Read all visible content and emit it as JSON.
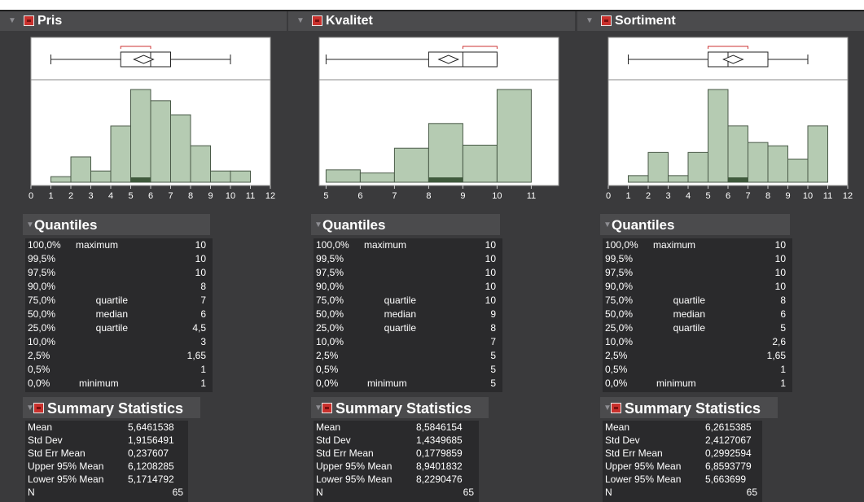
{
  "panels": [
    {
      "title": "Pris",
      "chart_data": {
        "type": "bar",
        "x_ticks": [
          "0",
          "1",
          "2",
          "3",
          "4",
          "5",
          "6",
          "7",
          "8",
          "9",
          "10",
          "11",
          "12"
        ],
        "xlim": [
          0,
          12
        ],
        "bins": [
          [
            1,
            2,
            2
          ],
          [
            2,
            3,
            9
          ],
          [
            3,
            4,
            4
          ],
          [
            4,
            5,
            20
          ],
          [
            5,
            6,
            33
          ],
          [
            6,
            7,
            29
          ],
          [
            7,
            8,
            24
          ],
          [
            8,
            9,
            13
          ],
          [
            9,
            10,
            4
          ],
          [
            10,
            11,
            4
          ]
        ],
        "box": {
          "whisker_low": 1,
          "q1": 4.5,
          "median": 6,
          "q3": 7,
          "whisker_high": 10,
          "mean": 5.65,
          "shortest_half": [
            4.5,
            6
          ]
        }
      },
      "quantiles_title": "Quantiles",
      "quantiles": [
        {
          "pct": "100,0%",
          "label": "maximum",
          "value": "10"
        },
        {
          "pct": "99,5%",
          "label": "",
          "value": "10"
        },
        {
          "pct": "97,5%",
          "label": "",
          "value": "10"
        },
        {
          "pct": "90,0%",
          "label": "",
          "value": "8"
        },
        {
          "pct": "75,0%",
          "label": "quartile",
          "value": "7"
        },
        {
          "pct": "50,0%",
          "label": "median",
          "value": "6"
        },
        {
          "pct": "25,0%",
          "label": "quartile",
          "value": "4,5"
        },
        {
          "pct": "10,0%",
          "label": "",
          "value": "3"
        },
        {
          "pct": "2,5%",
          "label": "",
          "value": "1,65"
        },
        {
          "pct": "0,5%",
          "label": "",
          "value": "1"
        },
        {
          "pct": "0,0%",
          "label": "minimum",
          "value": "1"
        }
      ],
      "summary_title": "Summary Statistics",
      "summary": [
        {
          "label": "Mean",
          "value": "5,6461538"
        },
        {
          "label": "Std Dev",
          "value": "1,9156491"
        },
        {
          "label": "Std Err Mean",
          "value": "0,237607"
        },
        {
          "label": "Upper 95% Mean",
          "value": "6,1208285"
        },
        {
          "label": "Lower 95% Mean",
          "value": "5,1714792"
        },
        {
          "label": "N",
          "value": "65"
        }
      ]
    },
    {
      "title": "Kvalitet",
      "chart_data": {
        "type": "bar",
        "x_ticks": [
          "5",
          "6",
          "7",
          "8",
          "9",
          "10",
          "11"
        ],
        "xlim": [
          4.8,
          11.8
        ],
        "bins": [
          [
            5,
            6,
            4
          ],
          [
            6,
            7,
            3
          ],
          [
            7,
            8,
            11
          ],
          [
            8,
            9,
            19
          ],
          [
            9,
            10,
            12
          ],
          [
            10,
            11,
            30
          ]
        ],
        "box": {
          "whisker_low": 5,
          "q1": 8,
          "median": 9,
          "q3": 10,
          "whisker_high": 10,
          "mean": 8.58,
          "shortest_half": [
            9,
            10
          ]
        }
      },
      "quantiles_title": "Quantiles",
      "quantiles": [
        {
          "pct": "100,0%",
          "label": "maximum",
          "value": "10"
        },
        {
          "pct": "99,5%",
          "label": "",
          "value": "10"
        },
        {
          "pct": "97,5%",
          "label": "",
          "value": "10"
        },
        {
          "pct": "90,0%",
          "label": "",
          "value": "10"
        },
        {
          "pct": "75,0%",
          "label": "quartile",
          "value": "10"
        },
        {
          "pct": "50,0%",
          "label": "median",
          "value": "9"
        },
        {
          "pct": "25,0%",
          "label": "quartile",
          "value": "8"
        },
        {
          "pct": "10,0%",
          "label": "",
          "value": "7"
        },
        {
          "pct": "2,5%",
          "label": "",
          "value": "5"
        },
        {
          "pct": "0,5%",
          "label": "",
          "value": "5"
        },
        {
          "pct": "0,0%",
          "label": "minimum",
          "value": "5"
        }
      ],
      "summary_title": "Summary Statistics",
      "summary": [
        {
          "label": "Mean",
          "value": "8,5846154"
        },
        {
          "label": "Std Dev",
          "value": "1,4349685"
        },
        {
          "label": "Std Err Mean",
          "value": "0,1779859"
        },
        {
          "label": "Upper 95% Mean",
          "value": "8,9401832"
        },
        {
          "label": "Lower 95% Mean",
          "value": "8,2290476"
        },
        {
          "label": "N",
          "value": "65"
        }
      ]
    },
    {
      "title": "Sortiment",
      "chart_data": {
        "type": "bar",
        "x_ticks": [
          "0",
          "1",
          "2",
          "3",
          "4",
          "5",
          "6",
          "7",
          "8",
          "9",
          "10",
          "11",
          "12"
        ],
        "xlim": [
          0,
          12
        ],
        "bins": [
          [
            1,
            2,
            2
          ],
          [
            2,
            3,
            9
          ],
          [
            3,
            4,
            2
          ],
          [
            4,
            5,
            9
          ],
          [
            5,
            6,
            28
          ],
          [
            6,
            7,
            17
          ],
          [
            7,
            8,
            12
          ],
          [
            8,
            9,
            11
          ],
          [
            9,
            10,
            7
          ],
          [
            10,
            11,
            17
          ]
        ],
        "box": {
          "whisker_low": 1,
          "q1": 5,
          "median": 6,
          "q3": 8,
          "whisker_high": 10,
          "mean": 6.26,
          "shortest_half": [
            5,
            7
          ]
        }
      },
      "quantiles_title": "Quantiles",
      "quantiles": [
        {
          "pct": "100,0%",
          "label": "maximum",
          "value": "10"
        },
        {
          "pct": "99,5%",
          "label": "",
          "value": "10"
        },
        {
          "pct": "97,5%",
          "label": "",
          "value": "10"
        },
        {
          "pct": "90,0%",
          "label": "",
          "value": "10"
        },
        {
          "pct": "75,0%",
          "label": "quartile",
          "value": "8"
        },
        {
          "pct": "50,0%",
          "label": "median",
          "value": "6"
        },
        {
          "pct": "25,0%",
          "label": "quartile",
          "value": "5"
        },
        {
          "pct": "10,0%",
          "label": "",
          "value": "2,6"
        },
        {
          "pct": "2,5%",
          "label": "",
          "value": "1,65"
        },
        {
          "pct": "0,5%",
          "label": "",
          "value": "1"
        },
        {
          "pct": "0,0%",
          "label": "minimum",
          "value": "1"
        }
      ],
      "summary_title": "Summary Statistics",
      "summary": [
        {
          "label": "Mean",
          "value": "6,2615385"
        },
        {
          "label": "Std Dev",
          "value": "2,4127067"
        },
        {
          "label": "Std Err Mean",
          "value": "0,2992594"
        },
        {
          "label": "Upper 95% Mean",
          "value": "6,8593779"
        },
        {
          "label": "Lower 95% Mean",
          "value": "5,663699"
        },
        {
          "label": "N",
          "value": "65"
        }
      ]
    }
  ],
  "colors": {
    "bar_fill": "#b5cbb2",
    "bar_stroke": "#4a5a48",
    "shortest_half": "#cc3333",
    "panel_bg": "#3a3a3c",
    "header_bg": "#4b4b4d",
    "table_bg": "#2a2a2c"
  }
}
